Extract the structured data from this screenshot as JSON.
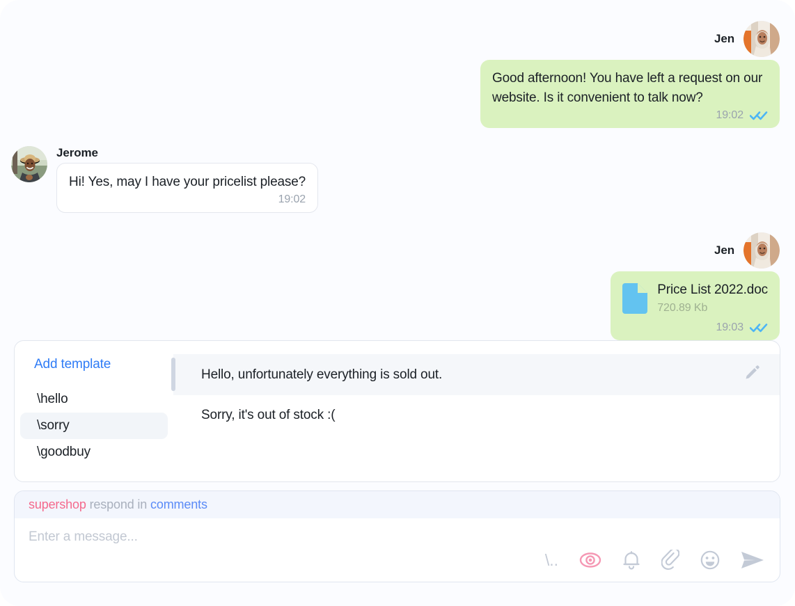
{
  "theme": {
    "page_background": "#fbfcff",
    "outgoing_bubble": "#daf2bf",
    "incoming_bubble": "#ffffff",
    "accent_blue": "#2f7cf6",
    "tick_blue": "#4db5f5",
    "file_icon_blue": "#63c3f0",
    "brand_pink": "#f4698c",
    "eye_pink": "#f598b4",
    "muted_gray": "#9aa3ae"
  },
  "conversation": {
    "messages": [
      {
        "id": "m1",
        "direction": "out",
        "sender": "Jen",
        "avatar": "jen-avatar",
        "type": "text",
        "text": "Good afternoon! You have left a request on our website. Is it convenient to talk now?",
        "time": "19:02",
        "status": "read",
        "status_icon": "double-check-icon"
      },
      {
        "id": "m2",
        "direction": "in",
        "sender": "Jerome",
        "avatar": "jerome-avatar",
        "type": "text",
        "text": "Hi! Yes, may I have your pricelist please?",
        "time": "19:02",
        "status": "none",
        "status_icon": ""
      },
      {
        "id": "m3",
        "direction": "out",
        "sender": "Jen",
        "avatar": "jen-avatar",
        "type": "file",
        "file_name": "Price List 2022.doc",
        "file_size": "720.89 Kb",
        "file_icon": "document-icon",
        "time": "19:03",
        "status": "read",
        "status_icon": "double-check-icon"
      }
    ]
  },
  "templates_panel": {
    "add_label": "Add template",
    "items": [
      {
        "label": "\\hello",
        "active": false
      },
      {
        "label": "\\sorry",
        "active": true
      },
      {
        "label": "\\goodbuy",
        "active": false
      }
    ],
    "previews": [
      {
        "text": "Hello, unfortunately everything is sold out.",
        "highlighted": true,
        "edit_icon": "pencil-icon"
      },
      {
        "text": "Sorry, it's out of stock :(",
        "highlighted": false,
        "edit_icon": ""
      }
    ]
  },
  "composer": {
    "header": {
      "brand": "supershop",
      "middle": " respond in ",
      "link": "comments"
    },
    "placeholder": "Enter a message...",
    "value": "",
    "tools": [
      {
        "name": "template-shortcut-icon",
        "label": "\\..",
        "active": false
      },
      {
        "name": "eye-icon",
        "label": "",
        "active": true
      },
      {
        "name": "bell-icon",
        "label": "",
        "active": false
      },
      {
        "name": "paperclip-icon",
        "label": "",
        "active": false
      },
      {
        "name": "emoji-icon",
        "label": "",
        "active": false
      },
      {
        "name": "send-icon",
        "label": "",
        "active": false
      }
    ]
  }
}
